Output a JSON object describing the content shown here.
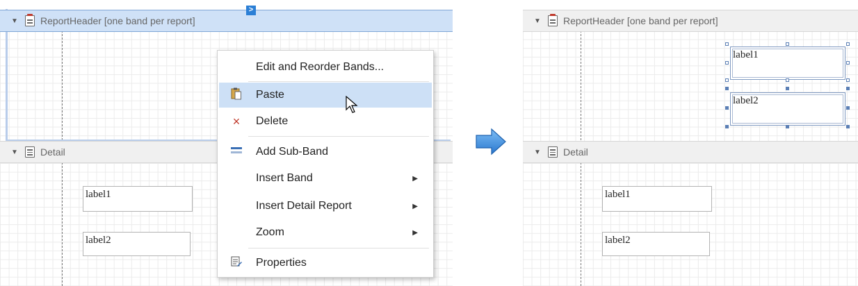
{
  "before": {
    "report_header": {
      "title": "ReportHeader [one band per report]"
    },
    "smart_tag": ">",
    "detail": {
      "title": "Detail",
      "labels": [
        "label1",
        "label2"
      ]
    },
    "context_menu": {
      "items": [
        {
          "label": "Edit and Reorder Bands...",
          "icon": "",
          "submenu": false
        },
        {
          "label": "Paste",
          "icon": "paste-icon",
          "submenu": false,
          "highlighted": true
        },
        {
          "label": "Delete",
          "icon": "delete-icon",
          "submenu": false
        },
        {
          "label": "Add Sub-Band",
          "icon": "sub-band-icon",
          "submenu": false
        },
        {
          "label": "Insert Band",
          "icon": "",
          "submenu": true
        },
        {
          "label": "Insert Detail Report",
          "icon": "",
          "submenu": true
        },
        {
          "label": "Zoom",
          "icon": "",
          "submenu": true
        },
        {
          "label": "Properties",
          "icon": "properties-icon",
          "submenu": false
        }
      ]
    }
  },
  "after": {
    "report_header": {
      "title": "ReportHeader [one band per report]",
      "labels": [
        "label1",
        "label2"
      ]
    },
    "detail": {
      "title": "Detail",
      "labels": [
        "label1",
        "label2"
      ]
    }
  },
  "colors": {
    "selection": "#cfe1f7",
    "highlight": "#cde0f6",
    "arrow": "#3a8fe0",
    "delete": "#c0392b"
  }
}
